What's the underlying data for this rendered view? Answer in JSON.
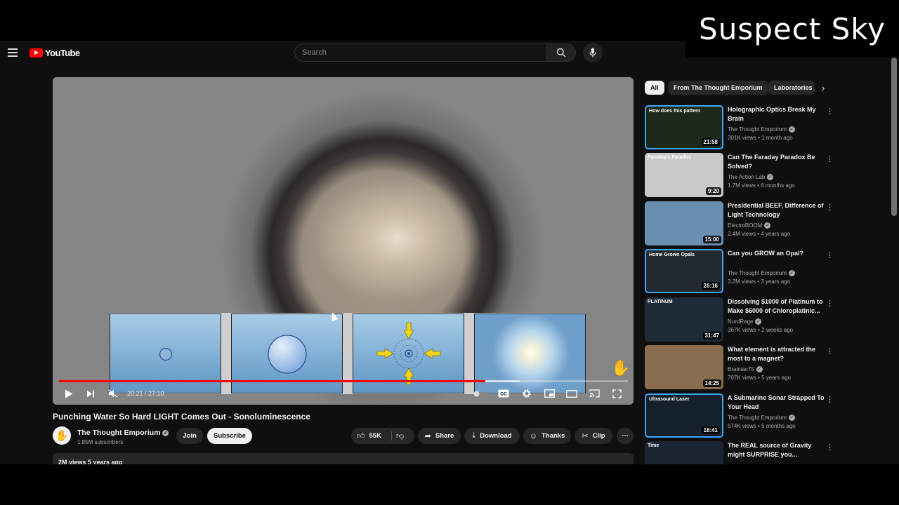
{
  "header": {
    "logo_text": "YouTube",
    "search_placeholder": "Search"
  },
  "watermark": "Suspect Sky",
  "player": {
    "current_time": "20:21",
    "duration": "27:10",
    "time_display": "20:21 / 27:10",
    "progress_fraction": 0.749,
    "buffered_fraction": 0.81,
    "muted": true,
    "cc_label": "CC"
  },
  "video": {
    "title": "Punching Water So Hard LIGHT Comes Out - Sonoluminescence",
    "channel": "The Thought Emporium",
    "subscribers": "1.85M subscribers",
    "join_label": "Join",
    "subscribe_label": "Subscribe",
    "likes": "55K",
    "share_label": "Share",
    "download_label": "Download",
    "thanks_label": "Thanks",
    "clip_label": "Clip",
    "views_date": "2M views  5 years ago"
  },
  "chips": [
    "All",
    "From The Thought Emporium",
    "Laboratories"
  ],
  "related": [
    {
      "title": "Holographic Optics Break My Brain",
      "channel": "The Thought Emporium",
      "meta": "301K views • 1 month ago",
      "duration": "21:58",
      "thumb_text": "How does this pattern",
      "thumb_color": "#1d2a1a",
      "border": "#3ea6ff"
    },
    {
      "title": "Can The Faraday Paradox Be Solved?",
      "channel": "The Action Lab",
      "meta": "1.7M views • 6 months ago",
      "duration": "9:20",
      "thumb_text": "Faraday's Paradox",
      "thumb_color": "#c9c9c9",
      "border": ""
    },
    {
      "title": "Presidential BEEF, Difference of Light Technology",
      "channel": "ElectroBOOM",
      "meta": "2.4M views • 4 years ago",
      "duration": "15:00",
      "thumb_text": "",
      "thumb_color": "#6b8fb2",
      "border": ""
    },
    {
      "title": "Can you GROW an Opal?",
      "channel": "The Thought Emporium",
      "meta": "3.2M views • 3 years ago",
      "duration": "26:16",
      "thumb_text": "Home Grown Opals",
      "thumb_color": "#222a2f",
      "border": "#3ea6ff"
    },
    {
      "title": "Dissolving $1000 of Platinum to Make $6000 of Chloroplatinic...",
      "channel": "NurdRage",
      "meta": "367K views • 2 weeks ago",
      "duration": "31:47",
      "thumb_text": "PLATINUM",
      "thumb_color": "#1e2b39",
      "border": ""
    },
    {
      "title": "What element is attracted the most to a magnet?",
      "channel": "Brainiac75",
      "meta": "707K views • 5 years ago",
      "duration": "14:25",
      "thumb_text": "",
      "thumb_color": "#8a6d4e",
      "border": ""
    },
    {
      "title": "A Submarine Sonar Strapped To Your Head",
      "channel": "The Thought Emporium",
      "meta": "574K views • 5 months ago",
      "duration": "18:41",
      "thumb_text": "Ultrasound Laser",
      "thumb_color": "#14202a",
      "border": "#3ea6ff"
    },
    {
      "title": "The REAL source of Gravity might SURPRISE you...",
      "channel": "",
      "meta": "",
      "duration": "",
      "thumb_text": "Time",
      "thumb_color": "#1b2433",
      "border": ""
    }
  ],
  "colors": {
    "background": "#0f0f0f",
    "accent_red": "#ff0000",
    "pill_bg": "#272727",
    "highlight_border": "#3ea6ff"
  }
}
